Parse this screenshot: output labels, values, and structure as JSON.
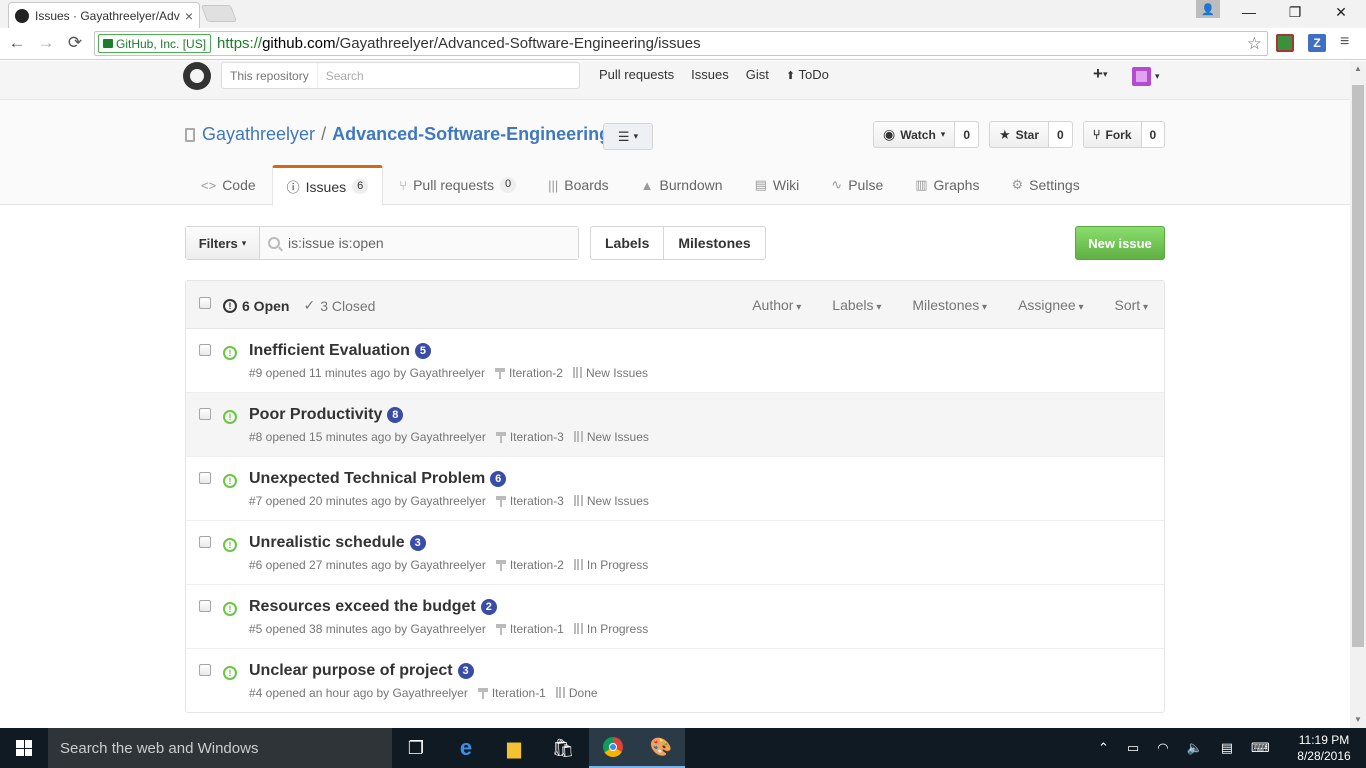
{
  "browser": {
    "tab_title": "Issues · Gayathreelyer/Adv",
    "tab_close": "×",
    "window_controls": {
      "minimize": "—",
      "restore": "❐",
      "close": "✕"
    },
    "ev_cert": "GitHub, Inc. [US]",
    "url_proto": "https://",
    "url_host": "github.com",
    "url_path": "/Gayathreelyer/Advanced-Software-Engineering/issues",
    "back_icon": "←",
    "forward_icon": "→",
    "reload_icon": "⟳",
    "bookmark_icon": "☆",
    "menu_icon": "≡",
    "ext_z": "Z"
  },
  "gh_header": {
    "scope": "This repository",
    "search_placeholder": "Search",
    "nav": [
      "Pull requests",
      "Issues",
      "Gist",
      "ToDo"
    ],
    "todo_icon": "🠉",
    "plus": "+"
  },
  "repo": {
    "owner": "Gayathreelyer",
    "separator": "/",
    "name": "Advanced-Software-Engineering",
    "watch_label": "Watch",
    "watch_count": "0",
    "star_label": "Star",
    "star_count": "0",
    "fork_label": "Fork",
    "fork_count": "0",
    "tabs": [
      {
        "icon": "<>",
        "label": "Code"
      },
      {
        "icon": "ⓘ",
        "label": "Issues",
        "count": "6"
      },
      {
        "icon": "⑂",
        "label": "Pull requests",
        "count": "0"
      },
      {
        "icon": "|||",
        "label": "Boards"
      },
      {
        "icon": "▲",
        "label": "Burndown"
      },
      {
        "icon": "▤",
        "label": "Wiki"
      },
      {
        "icon": "∿",
        "label": "Pulse"
      },
      {
        "icon": "▥",
        "label": "Graphs"
      },
      {
        "icon": "⚙",
        "label": "Settings"
      }
    ]
  },
  "subnav": {
    "filters_label": "Filters",
    "query": "is:issue is:open",
    "labels": "Labels",
    "milestones": "Milestones",
    "new_issue": "New issue"
  },
  "issues_table": {
    "open_count": "6 Open",
    "closed_count": "3 Closed",
    "filters": [
      "Author",
      "Labels",
      "Milestones",
      "Assignee",
      "Sort"
    ],
    "rows": [
      {
        "title": "Inefficient Evaluation",
        "comments": "5",
        "meta": "#9 opened 11 minutes ago by Gayathreelyer",
        "milestone": "Iteration-2",
        "project": "New Issues"
      },
      {
        "title": "Poor Productivity",
        "comments": "8",
        "meta": "#8 opened 15 minutes ago by Gayathreelyer",
        "milestone": "Iteration-3",
        "project": "New Issues"
      },
      {
        "title": "Unexpected Technical Problem",
        "comments": "6",
        "meta": "#7 opened 20 minutes ago by Gayathreelyer",
        "milestone": "Iteration-3",
        "project": "New Issues"
      },
      {
        "title": "Unrealistic schedule",
        "comments": "3",
        "meta": "#6 opened 27 minutes ago by Gayathreelyer",
        "milestone": "Iteration-2",
        "project": "In Progress"
      },
      {
        "title": "Resources exceed the budget",
        "comments": "2",
        "meta": "#5 opened 38 minutes ago by Gayathreelyer",
        "milestone": "Iteration-1",
        "project": "In Progress"
      },
      {
        "title": "Unclear purpose of project",
        "comments": "3",
        "meta": "#4 opened an hour ago by Gayathreelyer",
        "milestone": "Iteration-1",
        "project": "Done"
      }
    ]
  },
  "taskbar": {
    "search": "Search the web and Windows",
    "time": "11:19 PM",
    "date": "8/28/2016"
  },
  "colors": {
    "link": "#4078c0",
    "selected_tab_accent": "#d26911",
    "new_issue_green": "#60b044",
    "open_issue_green": "#6cc644",
    "comment_badge": "#3a4da6"
  }
}
